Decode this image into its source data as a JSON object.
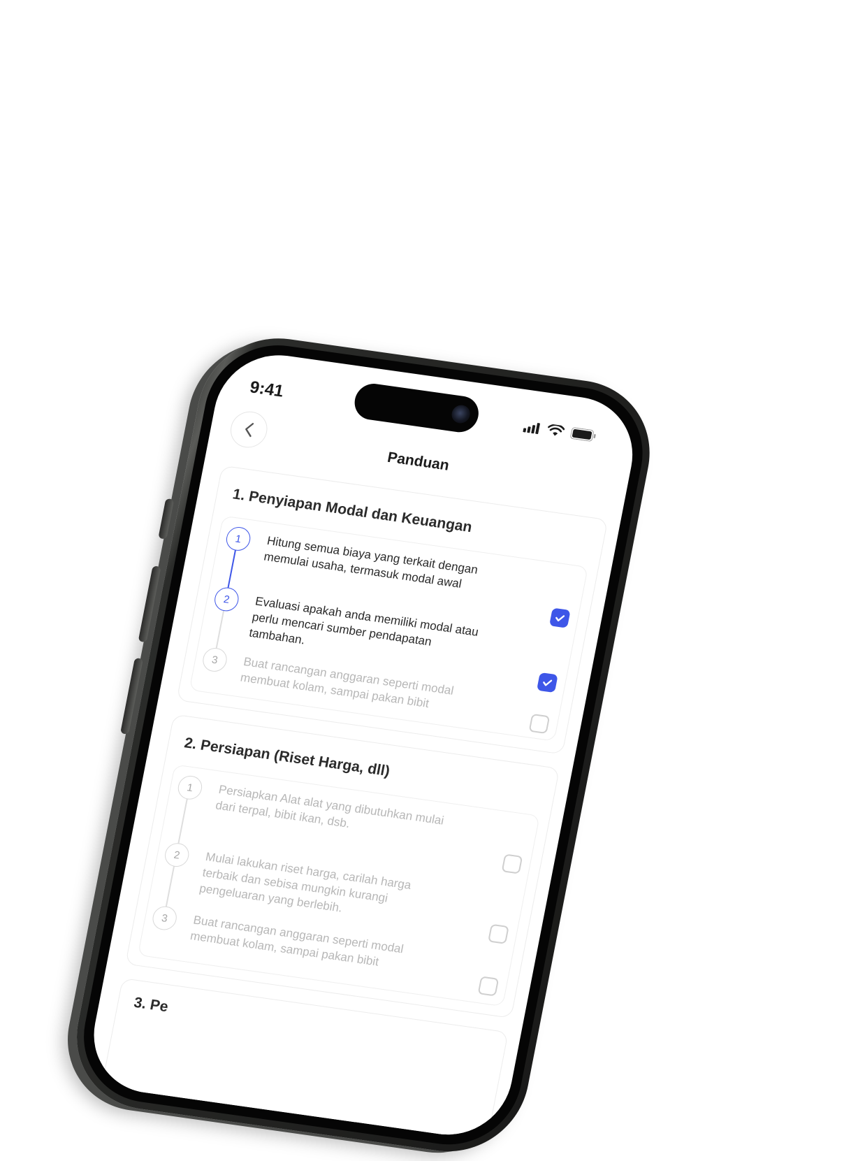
{
  "status_bar": {
    "time": "9:41"
  },
  "header": {
    "title": "Panduan"
  },
  "sections": [
    {
      "title": "1. Penyiapan Modal dan Keuangan",
      "steps": [
        {
          "number": "1",
          "text": "Hitung semua biaya yang terkait dengan memulai usaha, termasuk modal awal",
          "active": true,
          "checked": true
        },
        {
          "number": "2",
          "text": "Evaluasi apakah anda memiliki modal atau perlu mencari sumber pendapatan tambahan.",
          "active": true,
          "checked": true
        },
        {
          "number": "3",
          "text": "Buat rancangan anggaran seperti modal membuat kolam, sampai pakan bibit",
          "active": false,
          "checked": false
        }
      ]
    },
    {
      "title": "2. Persiapan (Riset Harga, dll)",
      "steps": [
        {
          "number": "1",
          "text": "Persiapkan Alat alat yang dibutuhkan mulai dari terpal, bibit ikan, dsb.",
          "active": false,
          "checked": false
        },
        {
          "number": "2",
          "text": "Mulai lakukan riset harga, carilah harga terbaik dan sebisa mungkin kurangi pengeluaran yang berlebih.",
          "active": false,
          "checked": false
        },
        {
          "number": "3",
          "text": "Buat rancangan anggaran seperti modal membuat kolam, sampai pakan bibit",
          "active": false,
          "checked": false
        }
      ]
    },
    {
      "title": "3. Pe"
    }
  ],
  "colors": {
    "accent": "#3e56e8",
    "muted_text": "#b7b7b7",
    "frame": "#2b2c2a"
  },
  "icons": [
    "chevron-left-icon",
    "signal-icon",
    "wifi-icon",
    "battery-icon",
    "checkmark-icon"
  ]
}
